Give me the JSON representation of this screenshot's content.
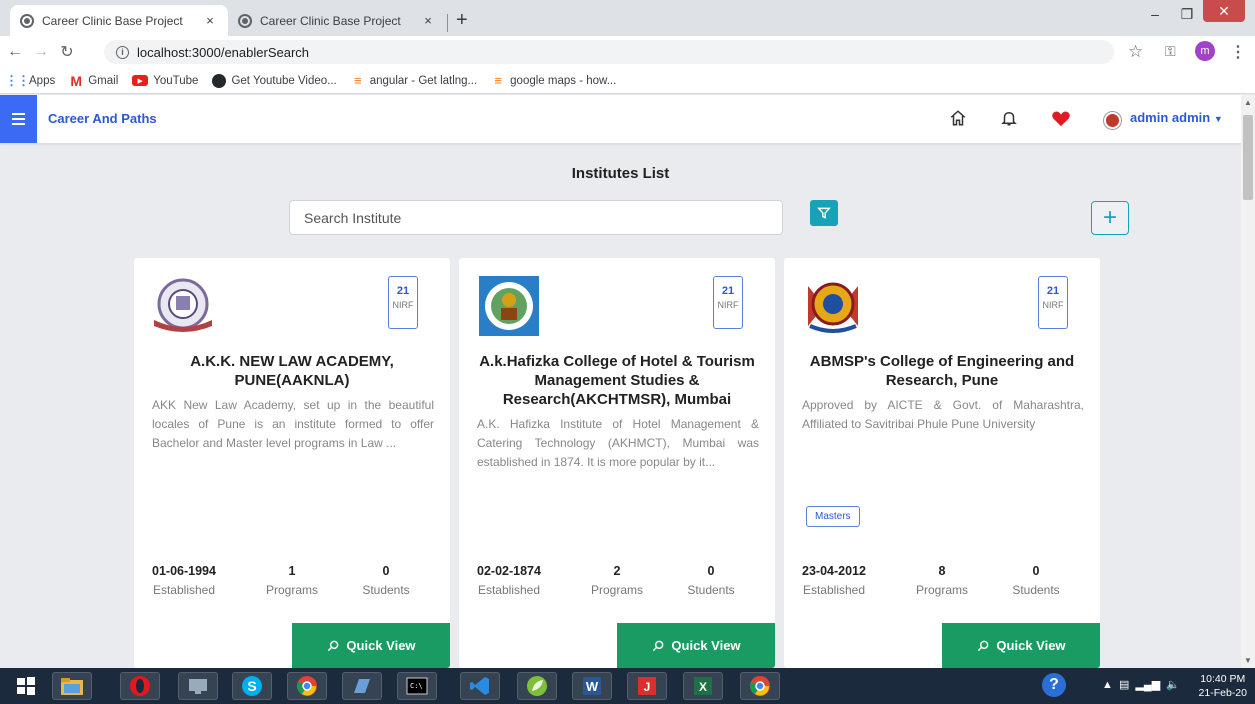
{
  "browser": {
    "tabs": [
      {
        "title": "Career Clinic Base Project",
        "close": "×"
      },
      {
        "title": "Career Clinic Base Project",
        "close": "×"
      }
    ],
    "new_tab": "+",
    "url": "localhost:3000/enablerSearch",
    "profile_initial": "m",
    "bookmarks": [
      {
        "label": "Apps",
        "icon": "apps-icon"
      },
      {
        "label": "Gmail",
        "icon": "gmail-icon"
      },
      {
        "label": "YouTube",
        "icon": "youtube-icon"
      },
      {
        "label": "Get Youtube Video...",
        "icon": "github-icon"
      },
      {
        "label": "angular - Get latlng...",
        "icon": "stackoverflow-icon"
      },
      {
        "label": "google maps - how...",
        "icon": "stackoverflow-icon"
      }
    ]
  },
  "header": {
    "brand": "Career And Paths",
    "user": "admin admin"
  },
  "main": {
    "title": "Institutes List",
    "search_placeholder": "Search Institute",
    "add_label": "+"
  },
  "cards": [
    {
      "nirf_num": "21",
      "nirf_label": "NIRF",
      "title": "A.K.K. NEW LAW ACADEMY, PUNE(AAKNLA)",
      "description": "AKK New Law Academy, set up in the beautiful locales of Pune is an institute formed to offer Bachelor and Master level programs in Law ...",
      "tag": "",
      "established": "01-06-1994",
      "programs": "1",
      "students": "0",
      "established_label": "Established",
      "programs_label": "Programs",
      "students_label": "Students",
      "quick_view": "Quick View"
    },
    {
      "nirf_num": "21",
      "nirf_label": "NIRF",
      "title": "A.k.Hafizka College of Hotel & Tourism Management Studies & Research(AKCHTMSR), Mumbai",
      "description": "A.K. Hafizka Institute of Hotel Management & Catering Technology (AKHMCT), Mumbai was established in 1874. It is more popular by it...",
      "tag": "",
      "established": "02-02-1874",
      "programs": "2",
      "students": "0",
      "established_label": "Established",
      "programs_label": "Programs",
      "students_label": "Students",
      "quick_view": "Quick View"
    },
    {
      "nirf_num": "21",
      "nirf_label": "NIRF",
      "title": "ABMSP's College of Engineering and Research, Pune",
      "description": "Approved by AICTE & Govt. of Maharashtra, Affiliated to Savitribai Phule Pune University",
      "tag": "Masters",
      "established": "23-04-2012",
      "programs": "8",
      "students": "0",
      "established_label": "Established",
      "programs_label": "Programs",
      "students_label": "Students",
      "quick_view": "Quick View"
    }
  ],
  "taskbar": {
    "time": "10:40 PM",
    "date": "21-Feb-20"
  },
  "colors": {
    "primary": "#2b58d6",
    "teal": "#17a2b8",
    "green": "#1a9b63",
    "heart": "#e01b24"
  }
}
